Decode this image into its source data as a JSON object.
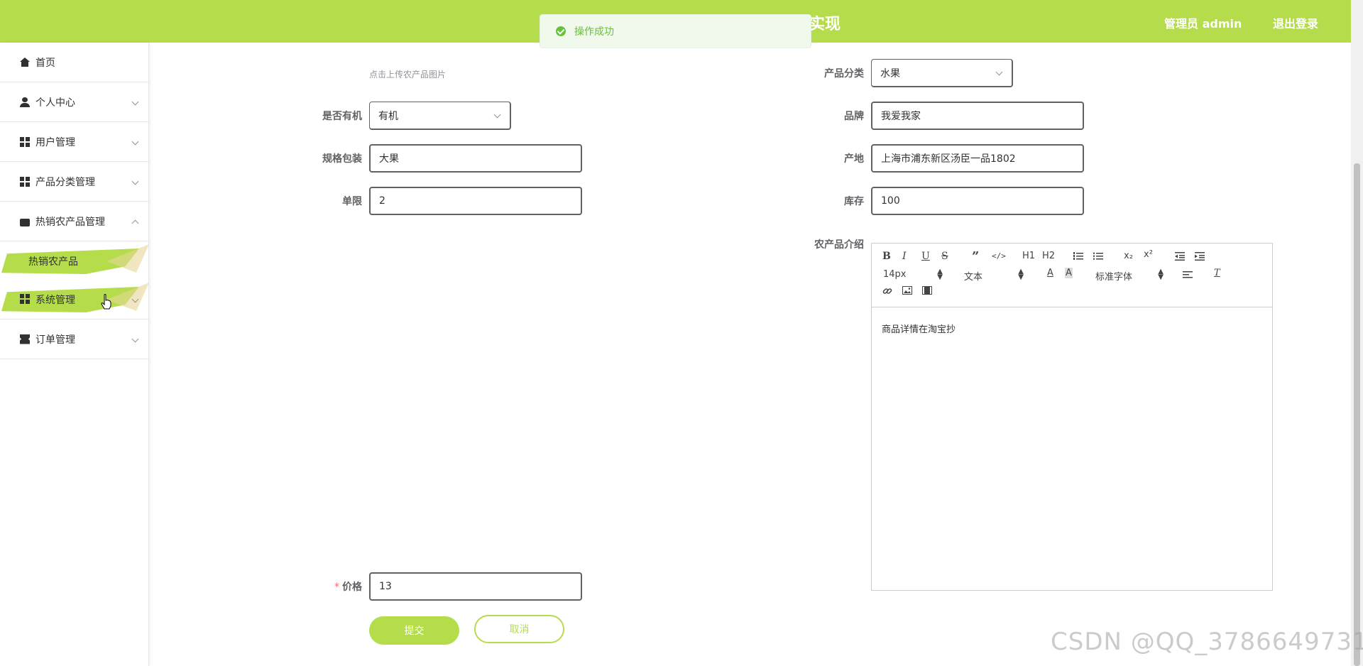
{
  "header": {
    "title_fragment": "实现",
    "user": "管理员 admin",
    "logout": "退出登录"
  },
  "toast": {
    "text": "操作成功",
    "type": "success"
  },
  "sidebar": {
    "items": [
      {
        "label": "首页",
        "icon": "home-icon"
      },
      {
        "label": "个人中心",
        "icon": "user-icon"
      },
      {
        "label": "用户管理",
        "icon": "grid-icon"
      },
      {
        "label": "产品分类管理",
        "icon": "grid-icon"
      },
      {
        "label": "热销农产品管理",
        "icon": "bag-icon",
        "expanded": true,
        "children": [
          {
            "label": "热销农产品",
            "active": true
          }
        ]
      },
      {
        "label": "系统管理",
        "icon": "grid-icon",
        "hovered": true
      },
      {
        "label": "订单管理",
        "icon": "ticket-icon"
      }
    ]
  },
  "form": {
    "upload_hint": "点击上传农产品图片",
    "organic": {
      "label": "是否有机",
      "value": "有机"
    },
    "spec": {
      "label": "规格包装",
      "value": "大果"
    },
    "limit": {
      "label": "单限",
      "value": "2"
    },
    "price": {
      "label": "价格",
      "value": "13",
      "required_mark": "*"
    },
    "category": {
      "label": "产品分类",
      "value": "水果"
    },
    "brand": {
      "label": "品牌",
      "value": "我爱我家"
    },
    "origin": {
      "label": "产地",
      "value": "上海市浦东新区汤臣一品1802"
    },
    "stock": {
      "label": "库存",
      "value": "100"
    },
    "intro": {
      "label": "农产品介绍",
      "content": "商品详情在淘宝抄",
      "toolbar": {
        "bold": "B",
        "italic": "I",
        "underline": "U",
        "strike": "S",
        "quote": "”",
        "code": "</>",
        "h1": "H1",
        "h2": "H2",
        "subscript": "x₂",
        "superscript": "x²",
        "font_size": "14px",
        "header_select": "文本",
        "font_family": "标准字体"
      }
    },
    "submit": "提交",
    "cancel": "取消"
  },
  "colors": {
    "primary": "#b5dd4b",
    "success": "#67c23a",
    "danger": "#f56c6c"
  },
  "watermark": "CSDN @QQ_3786649731"
}
